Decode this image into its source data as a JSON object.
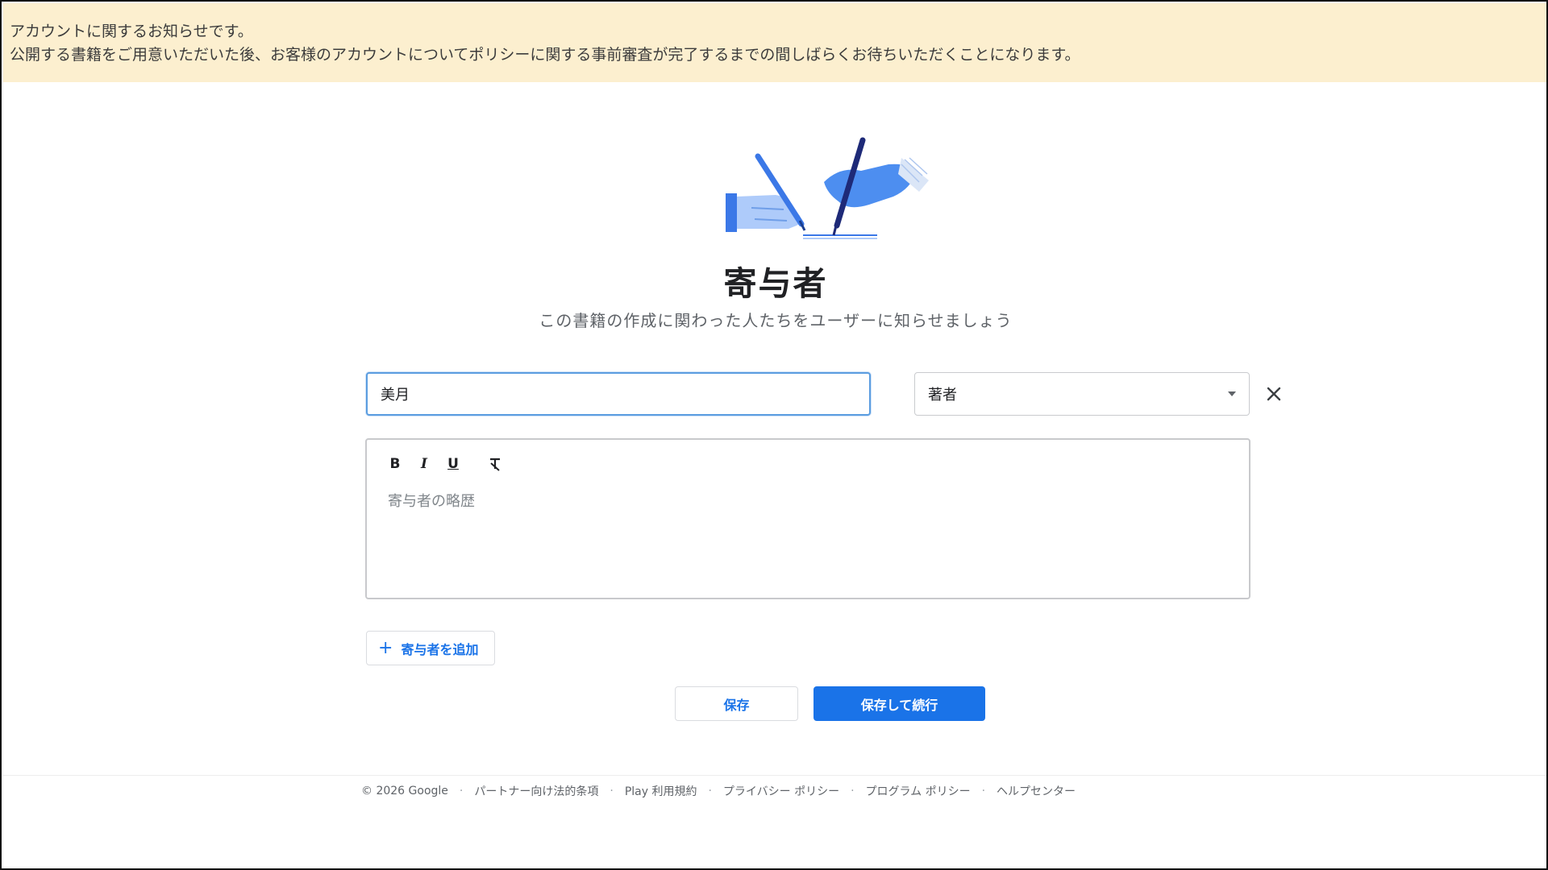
{
  "notice": {
    "line1": "アカウントに関するお知らせです。",
    "line2": "公開する書籍をご用意いただいた後、お客様のアカウントについてポリシーに関する事前審査が完了するまでの間しばらくお待ちいただくことになります。"
  },
  "page": {
    "title": "寄与者",
    "subtitle": "この書籍の作成に関わった人たちをユーザーに知らせましょう"
  },
  "contributor": {
    "name_value": "美月",
    "role_value": "著者",
    "bio_placeholder": "寄与者の略歴"
  },
  "toolbar": {
    "bold": "B",
    "italic": "I",
    "underline": "U"
  },
  "actions": {
    "add_contributor": "寄与者を追加",
    "save": "保存",
    "save_continue": "保存して続行"
  },
  "footer": {
    "links": [
      "© 2026 Google",
      "パートナー向け法的条項",
      "Play 利用規約",
      "プライバシー ポリシー",
      "プログラム ポリシー",
      "ヘルプセンター"
    ]
  },
  "colors": {
    "accent": "#1a73e8",
    "notice_bg": "#fcefcf",
    "input_focus": "#5b9de0"
  }
}
